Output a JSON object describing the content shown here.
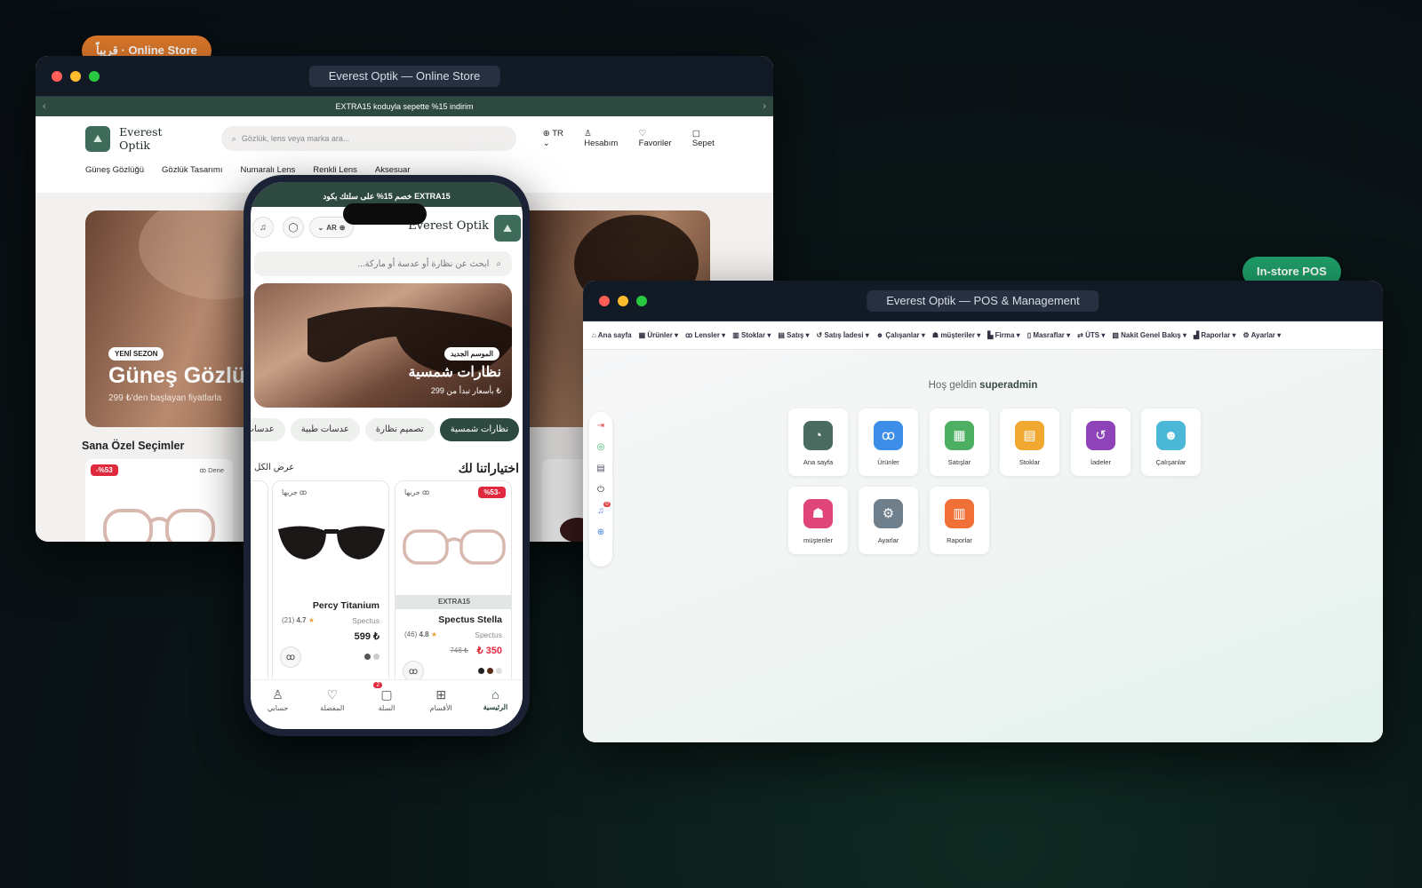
{
  "badges": {
    "online": "قريباً · Online Store",
    "pos": "In-store POS"
  },
  "online_store": {
    "window_title": "Everest Optik — Online Store",
    "promo": "EXTRA15 koduyla sepette %15 indirim",
    "brand": "Everest Optik",
    "search_placeholder": "Gözlük, lens veya marka ara...",
    "lang": "TR",
    "account": "Hesabım",
    "favorites": "Favoriler",
    "cart": "Sepet",
    "categories": [
      "Güneş Gözlüğü",
      "Gözlük Tasarımı",
      "Numaralı Lens",
      "Renkli Lens",
      "Aksesuar"
    ],
    "hero": {
      "tag": "YENİ SEZON",
      "title": "Güneş Gözlük",
      "subtitle": "299 ₺'den başlayan fiyatlarla"
    },
    "section_title": "Sana Özel Seçimler",
    "card": {
      "discount": "-%53",
      "try_label": "Dene"
    }
  },
  "phone": {
    "promo": "خصم 15% على سلتك بكود EXTRA15",
    "brand": "Everest Optik",
    "lang": "AR",
    "search_placeholder": "ابحث عن نظارة أو عدسة أو ماركة...",
    "hero": {
      "tag": "الموسم الجديد",
      "title": "نظارات شمسية",
      "subtitle": "بأسعار تبدأ من 299 ₺"
    },
    "chips": [
      "نظارات شمسية",
      "تصميم نظارة",
      "عدسات طبية",
      "عدسات ملونة"
    ],
    "section_title": "اختياراتنا لك",
    "view_all": "عرض الكل",
    "products": [
      {
        "try": "جربها",
        "discount": "%53-",
        "badge": "EXTRA15",
        "name": "Spectus Stella",
        "brand": "Spectus",
        "rating": "4.8",
        "reviews": "(46)",
        "old_price": "748 ₺",
        "price": "350 ₺"
      },
      {
        "try": "جربها",
        "name": "Percy Titanium",
        "brand": "Spectus",
        "rating": "4.7",
        "reviews": "(21)",
        "price": "599 ₺"
      }
    ],
    "tabs": [
      "الرئيسية",
      "الأقسام",
      "السلة",
      "المفضلة",
      "حسابي"
    ],
    "cart_count": "2"
  },
  "pos": {
    "window_title": "Everest Optik — POS & Management",
    "nav": [
      "Ana sayfa",
      "Ürünler",
      "Lensler",
      "Stoklar",
      "Satış",
      "Satış İadesi",
      "Çalışanlar",
      "müşteriler",
      "Firma",
      "Masraflar",
      "ÜTS",
      "Nakit Genel Bakış",
      "Raporlar",
      "Ayarlar"
    ],
    "welcome": "Hoş geldin",
    "user": "superadmin",
    "notif_count": "0",
    "tiles": [
      {
        "label": "Ana sayfa",
        "color": "#4a6b60",
        "icon": "◔"
      },
      {
        "label": "Ürünler",
        "color": "#3d8ee8",
        "icon": "∞"
      },
      {
        "label": "Satışlar",
        "color": "#4caf62",
        "icon": "▦"
      },
      {
        "label": "Stoklar",
        "color": "#f0a830",
        "icon": "▤"
      },
      {
        "label": "İadeler",
        "color": "#8e44b8",
        "icon": "↺"
      },
      {
        "label": "Çalışanlar",
        "color": "#4ab8d6",
        "icon": "☻"
      },
      {
        "label": "müşteriler",
        "color": "#e0457a",
        "icon": "☗"
      },
      {
        "label": "Ayarlar",
        "color": "#6f7f8c",
        "icon": "⚙"
      },
      {
        "label": "Raporlar",
        "color": "#f07038",
        "icon": "▥"
      }
    ]
  }
}
